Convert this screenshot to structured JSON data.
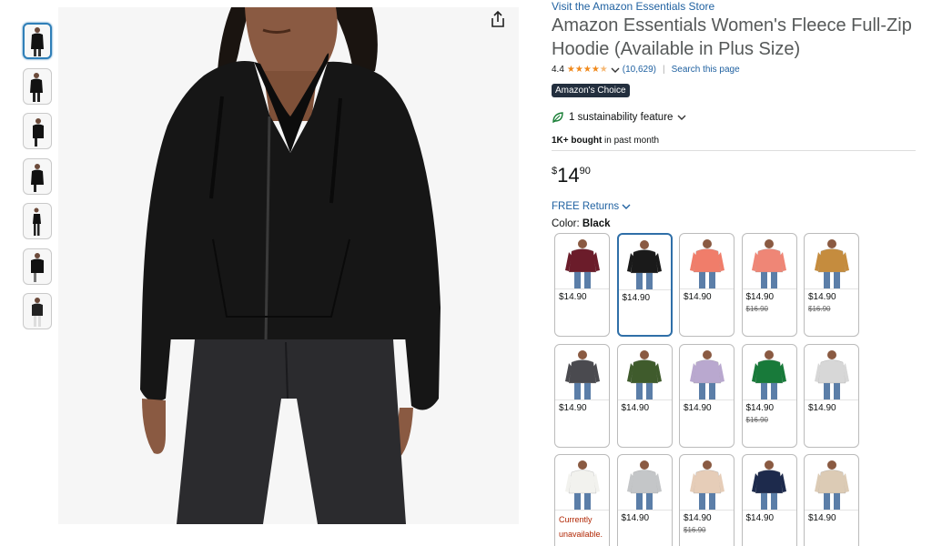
{
  "store_link": "Visit the Amazon Essentials Store",
  "title": "Amazon Essentials Women's Fleece Full-Zip Hoodie (Available in Plus Size)",
  "rating": {
    "value": "4.4",
    "stars": 4.4,
    "count": "(10,629)",
    "search_page": "Search this page"
  },
  "badge": "Amazon's Choice",
  "sustainability": "1 sustainability feature",
  "bought": {
    "bold": "1K+ bought",
    "rest": " in past month"
  },
  "price": {
    "currency": "$",
    "whole": "14",
    "fraction": "90"
  },
  "returns": "FREE Returns",
  "color": {
    "label": "Color: ",
    "value": "Black"
  },
  "swatches": [
    {
      "name": "burgundy",
      "color": "#6b1c2a",
      "price": "$14.90",
      "old": ""
    },
    {
      "name": "black",
      "color": "#1a1a1a",
      "price": "$14.90",
      "old": "",
      "selected": true
    },
    {
      "name": "coral",
      "color": "#f07d6a",
      "price": "$14.90",
      "old": ""
    },
    {
      "name": "salmon",
      "color": "#ef8676",
      "price": "$14.90",
      "old": "$16.90"
    },
    {
      "name": "camel",
      "color": "#c58c3e",
      "price": "$14.90",
      "old": "$16.90"
    },
    {
      "name": "charcoal",
      "color": "#4a4a4f",
      "price": "$14.90",
      "old": ""
    },
    {
      "name": "olive",
      "color": "#3f5b2c",
      "price": "$14.90",
      "old": ""
    },
    {
      "name": "lavender",
      "color": "#b9a8cf",
      "price": "$14.90",
      "old": ""
    },
    {
      "name": "green",
      "color": "#187a3a",
      "price": "$14.90",
      "old": "$16.90"
    },
    {
      "name": "leopard",
      "color": "#d7d7d7",
      "price": "$14.90",
      "old": ""
    },
    {
      "name": "white",
      "color": "#f2f2ee",
      "price": "",
      "old": "",
      "unavailable": "Currently unavailable."
    },
    {
      "name": "light-grey",
      "color": "#c4c6c8",
      "price": "$14.90",
      "old": ""
    },
    {
      "name": "beige",
      "color": "#e6cdb8",
      "price": "$14.90",
      "old": "$16.90"
    },
    {
      "name": "navy",
      "color": "#1d2a4c",
      "price": "$14.90",
      "old": ""
    },
    {
      "name": "oatmeal",
      "color": "#dccbb5",
      "price": "$14.90",
      "old": ""
    }
  ]
}
